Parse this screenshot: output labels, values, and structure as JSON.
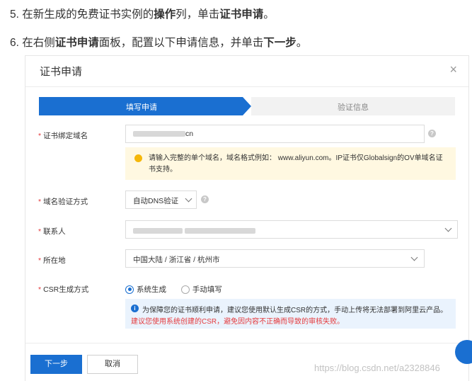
{
  "instructions": {
    "step5": {
      "prefix": "5. 在新生成的免费证书实例的",
      "bold1": "操作",
      "mid": "列，单击",
      "bold2": "证书申请",
      "suffix": "。"
    },
    "step6": {
      "prefix": "6. 在右侧",
      "bold1": "证书申请",
      "mid": "面板，配置以下申请信息，并单击",
      "bold2": "下一步",
      "suffix": "。"
    }
  },
  "dialog": {
    "title": "证书申请",
    "close_glyph": "×",
    "steps": [
      "填写申请",
      "验证信息"
    ],
    "fields": {
      "domain": {
        "label": "证书绑定域名",
        "value_suffix": "cn"
      },
      "domain_hint": "请输入完整的单个域名，域名格式例如： www.aliyun.com。IP证书仅Globalsign的OV单域名证书支持。",
      "verify_method": {
        "label": "域名验证方式",
        "value": "自动DNS验证"
      },
      "contact": {
        "label": "联系人"
      },
      "location": {
        "label": "所在地",
        "value": "中国大陆 / 浙江省 / 杭州市"
      },
      "csr": {
        "label": "CSR生成方式",
        "options": [
          "系统生成",
          "手动填写"
        ],
        "selected": "系统生成"
      },
      "csr_info_line1": "为保障您的证书顺利申请，建议您使用默认生成CSR的方式，手动上传将无法部署到阿里云产品。",
      "csr_info_line2": "建议您使用系统创建的CSR，避免因内容不正确而导致的审核失败。"
    },
    "footer": {
      "next_label": "下一步",
      "cancel_label": "取消"
    }
  },
  "watermark": "https://blog.csdn.net/a2328846",
  "colors": {
    "primary": "#1a6fd1",
    "required": "#e4393c",
    "warn_bg": "#fff8e1",
    "info_bg": "#eaf3fd"
  }
}
